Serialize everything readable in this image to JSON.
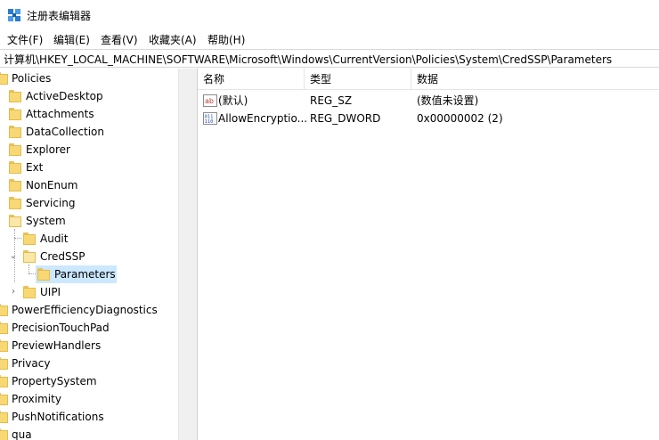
{
  "window": {
    "title": "注册表编辑器"
  },
  "menu": [
    "文件(F)",
    "编辑(E)",
    "查看(V)",
    "收藏夹(A)",
    "帮助(H)"
  ],
  "address": "计算机\\HKEY_LOCAL_MACHINE\\SOFTWARE\\Microsoft\\Windows\\CurrentVersion\\Policies\\System\\CredSSP\\Parameters",
  "tree": [
    {
      "label": "Policies"
    },
    {
      "label": "ActiveDesktop"
    },
    {
      "label": "Attachments"
    },
    {
      "label": "DataCollection"
    },
    {
      "label": "Explorer"
    },
    {
      "label": "Ext"
    },
    {
      "label": "NonEnum"
    },
    {
      "label": "Servicing"
    },
    {
      "label": "System"
    },
    {
      "label": "Audit"
    },
    {
      "label": "CredSSP"
    },
    {
      "label": "Parameters"
    },
    {
      "label": "UIPI"
    },
    {
      "label": "PowerEfficiencyDiagnostics"
    },
    {
      "label": "PrecisionTouchPad"
    },
    {
      "label": "PreviewHandlers"
    },
    {
      "label": "Privacy"
    },
    {
      "label": "PropertySystem"
    },
    {
      "label": "Proximity"
    },
    {
      "label": "PushNotifications"
    },
    {
      "label": "qua"
    }
  ],
  "columns": [
    "名称",
    "类型",
    "数据"
  ],
  "values": [
    {
      "name": "(默认)",
      "type": "REG_SZ",
      "data": "(数值未设置)",
      "icon": "string-value-icon"
    },
    {
      "name": "AllowEncryptio...",
      "type": "REG_DWORD",
      "data": "0x00000002 (2)",
      "icon": "binary-value-icon"
    }
  ]
}
